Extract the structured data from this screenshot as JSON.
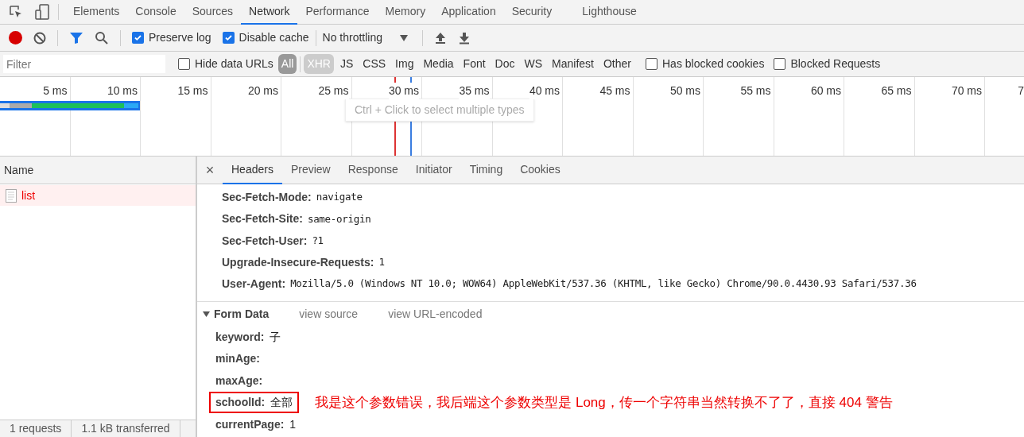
{
  "devtools_tabs": [
    {
      "label": "Elements",
      "selected": false
    },
    {
      "label": "Console",
      "selected": false
    },
    {
      "label": "Sources",
      "selected": false
    },
    {
      "label": "Network",
      "selected": true
    },
    {
      "label": "Performance",
      "selected": false
    },
    {
      "label": "Memory",
      "selected": false
    },
    {
      "label": "Application",
      "selected": false
    },
    {
      "label": "Security",
      "selected": false
    },
    {
      "label": "Lighthouse",
      "selected": false
    }
  ],
  "toolbar": {
    "recording": true,
    "preserve_log": {
      "label": "Preserve log",
      "checked": true
    },
    "disable_cache": {
      "label": "Disable cache",
      "checked": true
    },
    "throttling": "No throttling"
  },
  "filter_bar": {
    "placeholder": "Filter",
    "hide_data_urls": {
      "label": "Hide data URLs",
      "checked": false
    },
    "types": [
      {
        "label": "All",
        "selected": true,
        "hovered": false
      },
      {
        "label": "XHR",
        "selected": false,
        "hovered": true
      },
      {
        "label": "JS",
        "selected": false,
        "hovered": false
      },
      {
        "label": "CSS",
        "selected": false,
        "hovered": false
      },
      {
        "label": "Img",
        "selected": false,
        "hovered": false
      },
      {
        "label": "Media",
        "selected": false,
        "hovered": false
      },
      {
        "label": "Font",
        "selected": false,
        "hovered": false
      },
      {
        "label": "Doc",
        "selected": false,
        "hovered": false
      },
      {
        "label": "WS",
        "selected": false,
        "hovered": false
      },
      {
        "label": "Manifest",
        "selected": false,
        "hovered": false
      },
      {
        "label": "Other",
        "selected": false,
        "hovered": false
      }
    ],
    "has_blocked_cookies": {
      "label": "Has blocked cookies",
      "checked": false
    },
    "blocked_requests": {
      "label": "Blocked Requests",
      "checked": false
    }
  },
  "timeline": {
    "ticks": [
      "5 ms",
      "10 ms",
      "15 ms",
      "20 ms",
      "25 ms",
      "30 ms",
      "35 ms",
      "40 ms",
      "45 ms",
      "50 ms",
      "55 ms",
      "60 ms",
      "65 ms",
      "70 ms",
      "7"
    ],
    "tooltip": "Ctrl + Click to select multiple types"
  },
  "requests": {
    "column": "Name",
    "rows": [
      {
        "name": "list",
        "error": true
      }
    ]
  },
  "status_bar": [
    "1 requests",
    "1.1 kB transferred"
  ],
  "detail_tabs": [
    {
      "label": "Headers",
      "selected": true
    },
    {
      "label": "Preview",
      "selected": false
    },
    {
      "label": "Response",
      "selected": false
    },
    {
      "label": "Initiator",
      "selected": false
    },
    {
      "label": "Timing",
      "selected": false
    },
    {
      "label": "Cookies",
      "selected": false
    }
  ],
  "close_label": "×",
  "request_headers": [
    {
      "name": "Sec-Fetch-Mode:",
      "value": "navigate"
    },
    {
      "name": "Sec-Fetch-Site:",
      "value": "same-origin"
    },
    {
      "name": "Sec-Fetch-User:",
      "value": "?1"
    },
    {
      "name": "Upgrade-Insecure-Requests:",
      "value": "1"
    },
    {
      "name": "User-Agent:",
      "value": "Mozilla/5.0 (Windows NT 10.0; WOW64) AppleWebKit/537.36 (KHTML, like Gecko) Chrome/90.0.4430.93 Safari/537.36"
    }
  ],
  "form_data": {
    "title": "Form Data",
    "expanded": true,
    "links": [
      "view source",
      "view URL-encoded"
    ],
    "fields": [
      {
        "name": "keyword:",
        "value": "子",
        "boxed": false
      },
      {
        "name": "minAge:",
        "boxed": false
      },
      {
        "name": "maxAge:",
        "boxed": false
      },
      {
        "name": "schoolId:",
        "value": "全部",
        "boxed": true
      },
      {
        "name": "currentPage:",
        "value": "1",
        "boxed": false
      }
    ]
  },
  "annotation": "我是这个参数错误，我后端这个参数类型是 Long，传一个字符串当然转换不了了，直接 404 警告"
}
